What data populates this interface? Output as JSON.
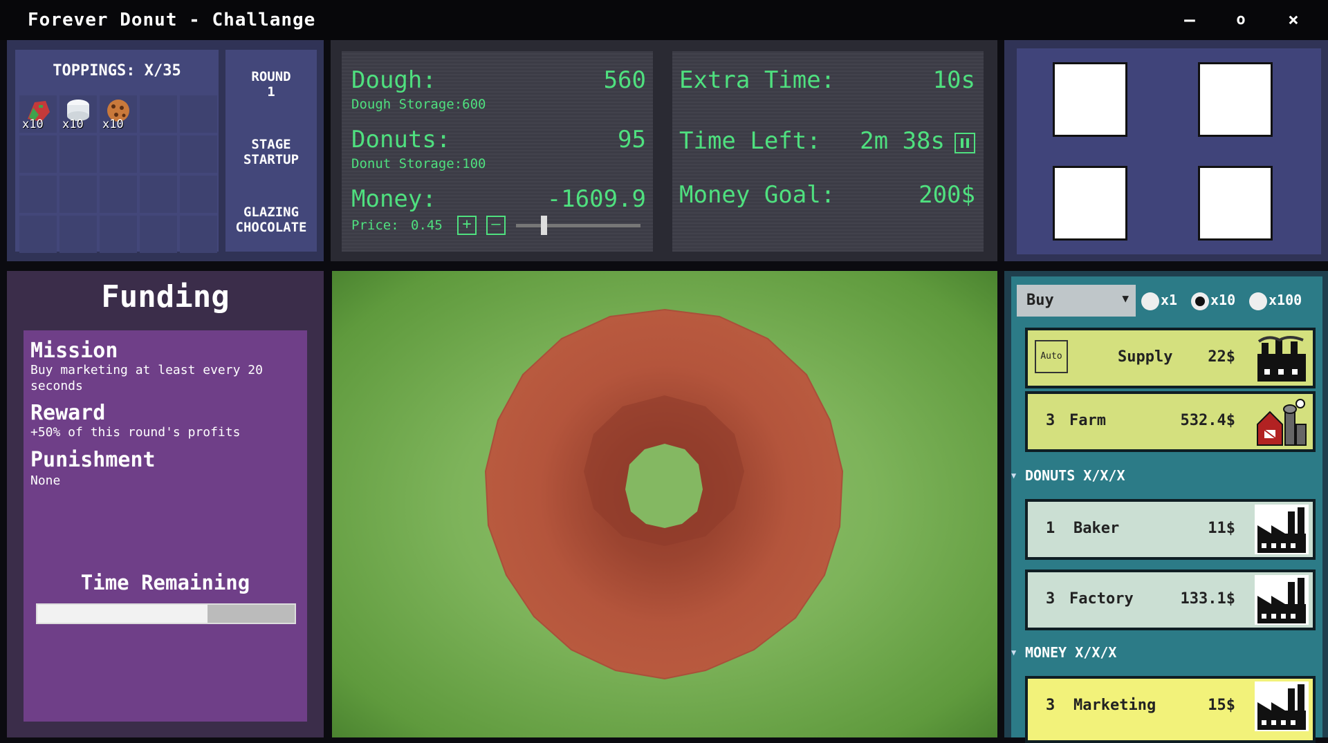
{
  "window": {
    "title": "Forever Donut - Challange",
    "minimize": "–",
    "maximize": "o",
    "close": "×"
  },
  "toppings": {
    "header": "TOPPINGS: X/35",
    "items": [
      {
        "name": "sprinkles-topping",
        "qty": "x10",
        "color": "#c43a3a"
      },
      {
        "name": "marshmallow-topping",
        "qty": "x10",
        "color": "#e8ecef"
      },
      {
        "name": "cookie-topping",
        "qty": "x10",
        "color": "#c9793b"
      }
    ]
  },
  "round": {
    "round_label": "ROUND",
    "round_num": "1",
    "stage_line1": "STAGE",
    "stage_line2": "STARTUP",
    "glaze_line1": "GLAZING",
    "glaze_line2": "CHOCOLATE"
  },
  "stats": {
    "dough_label": "Dough:",
    "dough_value": "560",
    "dough_storage": "Dough Storage:600",
    "donuts_label": "Donuts:",
    "donuts_value": "95",
    "donut_storage": "Donut Storage:100",
    "money_label": "Money:",
    "money_value": "-1609.9",
    "price_label": "Price:",
    "price_value": "0.45",
    "plus": "+",
    "minus": "–",
    "price_slider_fraction": 0.2,
    "extra_time_label": "Extra Time:",
    "extra_time_value": "10s",
    "time_left_label": "Time Left:",
    "time_left_value": "2m 38s",
    "money_goal_label": "Money Goal:",
    "money_goal_value": "200$"
  },
  "funding": {
    "title": "Funding",
    "mission_head": "Mission",
    "mission_text": "Buy marketing at least every 20 seconds",
    "reward_head": "Reward",
    "reward_text": "+50% of this round's profits",
    "punishment_head": "Punishment",
    "punishment_text": "None",
    "time_remaining": "Time Remaining",
    "time_remaining_fraction": 0.66
  },
  "shop": {
    "mode": "Buy",
    "options": [
      "x1",
      "x10",
      "x100"
    ],
    "selected": "x10",
    "cards": [
      {
        "name": "Supply",
        "num": "",
        "price": "22$",
        "auto": "Auto",
        "color": "#d4e07e",
        "icon": "factory-icon"
      },
      {
        "name": "Farm",
        "num": "3",
        "price": "532.4$",
        "color": "#d4e07e",
        "icon": "barn-icon"
      },
      {
        "name": "Baker",
        "num": "1",
        "price": "11$",
        "color": "#cbdfd3",
        "icon": "factory-icon"
      },
      {
        "name": "Factory",
        "num": "3",
        "price": "133.1$",
        "color": "#cbdfd3",
        "icon": "factory-icon"
      },
      {
        "name": "Marketing",
        "num": "3",
        "price": "15$",
        "color": "#f2f27a",
        "icon": "factory-icon"
      }
    ],
    "group_donuts": "DONUTS X/X/X",
    "group_money": "MONEY X/X/X"
  },
  "colors": {
    "stat_green": "#4fe07f",
    "donut": "#b7533c",
    "field": "#7db35a"
  }
}
